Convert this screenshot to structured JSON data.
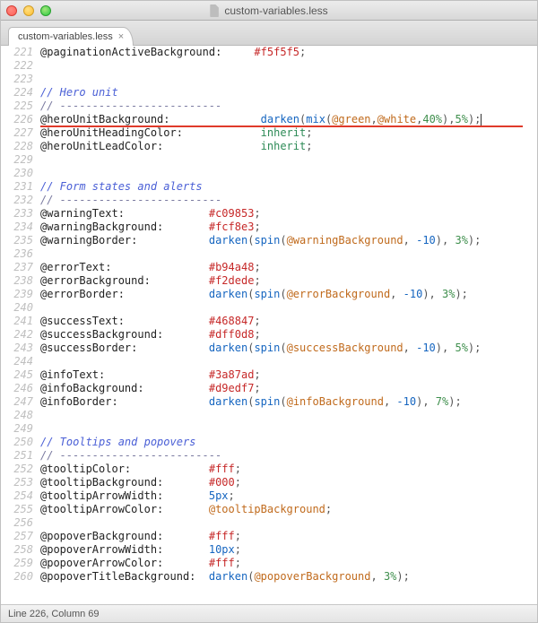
{
  "window": {
    "title": "custom-variables.less"
  },
  "tab": {
    "label": "custom-variables.less",
    "close": "×"
  },
  "status": {
    "text": "Line 226, Column 69"
  },
  "code_lines": [
    {
      "n": 221,
      "t": "code",
      "tokens": [
        [
          "var",
          "@paginationActiveBackground:"
        ],
        [
          "pad",
          "     "
        ],
        [
          "hex",
          "#f5f5f5"
        ],
        [
          "punct",
          ";"
        ]
      ]
    },
    {
      "n": 222,
      "t": "blank"
    },
    {
      "n": 223,
      "t": "blank"
    },
    {
      "n": 224,
      "t": "comment-em",
      "text": "// Hero unit"
    },
    {
      "n": 225,
      "t": "comment",
      "text": "// -------------------------"
    },
    {
      "n": 226,
      "t": "code",
      "hl": true,
      "tokens": [
        [
          "var",
          "@heroUnitBackground:"
        ],
        [
          "pad",
          "              "
        ],
        [
          "func",
          "darken"
        ],
        [
          "punct",
          "("
        ],
        [
          "func",
          "mix"
        ],
        [
          "punct",
          "("
        ],
        [
          "param",
          "@green"
        ],
        [
          "punct",
          ","
        ],
        [
          "param",
          "@white"
        ],
        [
          "punct",
          ","
        ],
        [
          "numg",
          "40%"
        ],
        [
          "punct",
          "),"
        ],
        [
          "numg",
          "5%"
        ],
        [
          "punct",
          ");"
        ],
        [
          "cursor",
          ""
        ]
      ]
    },
    {
      "n": 227,
      "t": "code",
      "tokens": [
        [
          "var",
          "@heroUnitHeadingColor:"
        ],
        [
          "pad",
          "            "
        ],
        [
          "inherit",
          "inherit"
        ],
        [
          "punct",
          ";"
        ]
      ]
    },
    {
      "n": 228,
      "t": "code",
      "tokens": [
        [
          "var",
          "@heroUnitLeadColor:"
        ],
        [
          "pad",
          "               "
        ],
        [
          "inherit",
          "inherit"
        ],
        [
          "punct",
          ";"
        ]
      ]
    },
    {
      "n": 229,
      "t": "blank"
    },
    {
      "n": 230,
      "t": "blank"
    },
    {
      "n": 231,
      "t": "comment-em",
      "text": "// Form states and alerts"
    },
    {
      "n": 232,
      "t": "comment",
      "text": "// -------------------------"
    },
    {
      "n": 233,
      "t": "code",
      "tokens": [
        [
          "var",
          "@warningText:"
        ],
        [
          "pad",
          "             "
        ],
        [
          "hex",
          "#c09853"
        ],
        [
          "punct",
          ";"
        ]
      ]
    },
    {
      "n": 234,
      "t": "code",
      "tokens": [
        [
          "var",
          "@warningBackground:"
        ],
        [
          "pad",
          "       "
        ],
        [
          "hex",
          "#fcf8e3"
        ],
        [
          "punct",
          ";"
        ]
      ]
    },
    {
      "n": 235,
      "t": "code",
      "tokens": [
        [
          "var",
          "@warningBorder:"
        ],
        [
          "pad",
          "           "
        ],
        [
          "func",
          "darken"
        ],
        [
          "punct",
          "("
        ],
        [
          "func",
          "spin"
        ],
        [
          "punct",
          "("
        ],
        [
          "param",
          "@warningBackground"
        ],
        [
          "punct",
          ", "
        ],
        [
          "numb",
          "-10"
        ],
        [
          "punct",
          "), "
        ],
        [
          "numg",
          "3%"
        ],
        [
          "punct",
          ");"
        ]
      ]
    },
    {
      "n": 236,
      "t": "blank"
    },
    {
      "n": 237,
      "t": "code",
      "tokens": [
        [
          "var",
          "@errorText:"
        ],
        [
          "pad",
          "               "
        ],
        [
          "hex",
          "#b94a48"
        ],
        [
          "punct",
          ";"
        ]
      ]
    },
    {
      "n": 238,
      "t": "code",
      "tokens": [
        [
          "var",
          "@errorBackground:"
        ],
        [
          "pad",
          "         "
        ],
        [
          "hex",
          "#f2dede"
        ],
        [
          "punct",
          ";"
        ]
      ]
    },
    {
      "n": 239,
      "t": "code",
      "tokens": [
        [
          "var",
          "@errorBorder:"
        ],
        [
          "pad",
          "             "
        ],
        [
          "func",
          "darken"
        ],
        [
          "punct",
          "("
        ],
        [
          "func",
          "spin"
        ],
        [
          "punct",
          "("
        ],
        [
          "param",
          "@errorBackground"
        ],
        [
          "punct",
          ", "
        ],
        [
          "numb",
          "-10"
        ],
        [
          "punct",
          "), "
        ],
        [
          "numg",
          "3%"
        ],
        [
          "punct",
          ");"
        ]
      ]
    },
    {
      "n": 240,
      "t": "blank"
    },
    {
      "n": 241,
      "t": "code",
      "tokens": [
        [
          "var",
          "@successText:"
        ],
        [
          "pad",
          "             "
        ],
        [
          "hex",
          "#468847"
        ],
        [
          "punct",
          ";"
        ]
      ]
    },
    {
      "n": 242,
      "t": "code",
      "tokens": [
        [
          "var",
          "@successBackground:"
        ],
        [
          "pad",
          "       "
        ],
        [
          "hex",
          "#dff0d8"
        ],
        [
          "punct",
          ";"
        ]
      ]
    },
    {
      "n": 243,
      "t": "code",
      "tokens": [
        [
          "var",
          "@successBorder:"
        ],
        [
          "pad",
          "           "
        ],
        [
          "func",
          "darken"
        ],
        [
          "punct",
          "("
        ],
        [
          "func",
          "spin"
        ],
        [
          "punct",
          "("
        ],
        [
          "param",
          "@successBackground"
        ],
        [
          "punct",
          ", "
        ],
        [
          "numb",
          "-10"
        ],
        [
          "punct",
          "), "
        ],
        [
          "numg",
          "5%"
        ],
        [
          "punct",
          ");"
        ]
      ]
    },
    {
      "n": 244,
      "t": "blank"
    },
    {
      "n": 245,
      "t": "code",
      "tokens": [
        [
          "var",
          "@infoText:"
        ],
        [
          "pad",
          "                "
        ],
        [
          "hex",
          "#3a87ad"
        ],
        [
          "punct",
          ";"
        ]
      ]
    },
    {
      "n": 246,
      "t": "code",
      "tokens": [
        [
          "var",
          "@infoBackground:"
        ],
        [
          "pad",
          "          "
        ],
        [
          "hex",
          "#d9edf7"
        ],
        [
          "punct",
          ";"
        ]
      ]
    },
    {
      "n": 247,
      "t": "code",
      "tokens": [
        [
          "var",
          "@infoBorder:"
        ],
        [
          "pad",
          "              "
        ],
        [
          "func",
          "darken"
        ],
        [
          "punct",
          "("
        ],
        [
          "func",
          "spin"
        ],
        [
          "punct",
          "("
        ],
        [
          "param",
          "@infoBackground"
        ],
        [
          "punct",
          ", "
        ],
        [
          "numb",
          "-10"
        ],
        [
          "punct",
          "), "
        ],
        [
          "numg",
          "7%"
        ],
        [
          "punct",
          ");"
        ]
      ]
    },
    {
      "n": 248,
      "t": "blank"
    },
    {
      "n": 249,
      "t": "blank"
    },
    {
      "n": 250,
      "t": "comment-em",
      "text": "// Tooltips and popovers"
    },
    {
      "n": 251,
      "t": "comment",
      "text": "// -------------------------"
    },
    {
      "n": 252,
      "t": "code",
      "tokens": [
        [
          "var",
          "@tooltipColor:"
        ],
        [
          "pad",
          "            "
        ],
        [
          "hex",
          "#fff"
        ],
        [
          "punct",
          ";"
        ]
      ]
    },
    {
      "n": 253,
      "t": "code",
      "tokens": [
        [
          "var",
          "@tooltipBackground:"
        ],
        [
          "pad",
          "       "
        ],
        [
          "hex",
          "#000"
        ],
        [
          "punct",
          ";"
        ]
      ]
    },
    {
      "n": 254,
      "t": "code",
      "tokens": [
        [
          "var",
          "@tooltipArrowWidth:"
        ],
        [
          "pad",
          "       "
        ],
        [
          "numb",
          "5px"
        ],
        [
          "punct",
          ";"
        ]
      ]
    },
    {
      "n": 255,
      "t": "code",
      "tokens": [
        [
          "var",
          "@tooltipArrowColor:"
        ],
        [
          "pad",
          "       "
        ],
        [
          "param",
          "@tooltipBackground"
        ],
        [
          "punct",
          ";"
        ]
      ]
    },
    {
      "n": 256,
      "t": "blank"
    },
    {
      "n": 257,
      "t": "code",
      "tokens": [
        [
          "var",
          "@popoverBackground:"
        ],
        [
          "pad",
          "       "
        ],
        [
          "hex",
          "#fff"
        ],
        [
          "punct",
          ";"
        ]
      ]
    },
    {
      "n": 258,
      "t": "code",
      "tokens": [
        [
          "var",
          "@popoverArrowWidth:"
        ],
        [
          "pad",
          "       "
        ],
        [
          "numb",
          "10px"
        ],
        [
          "punct",
          ";"
        ]
      ]
    },
    {
      "n": 259,
      "t": "code",
      "tokens": [
        [
          "var",
          "@popoverArrowColor:"
        ],
        [
          "pad",
          "       "
        ],
        [
          "hex",
          "#fff"
        ],
        [
          "punct",
          ";"
        ]
      ]
    },
    {
      "n": 260,
      "t": "code",
      "tokens": [
        [
          "var",
          "@popoverTitleBackground:"
        ],
        [
          "pad",
          "  "
        ],
        [
          "func",
          "darken"
        ],
        [
          "punct",
          "("
        ],
        [
          "param",
          "@popoverBackground"
        ],
        [
          "punct",
          ", "
        ],
        [
          "numg",
          "3%"
        ],
        [
          "punct",
          ");"
        ]
      ]
    }
  ]
}
